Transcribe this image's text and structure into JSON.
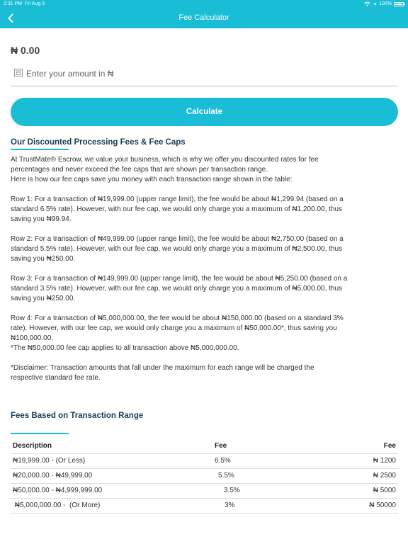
{
  "status_bar": {
    "time": "2:31 PM",
    "date": "Fri Aug 9",
    "battery": "100%"
  },
  "nav": {
    "title": "Fee Calculator",
    "back_icon": "chevron-left-icon"
  },
  "amount_display": "₦ 0.00",
  "amount_input": {
    "placeholder": "Enter your amount in ₦",
    "value": ""
  },
  "calculate_label": "Calculate",
  "discount_section": {
    "title": "Our Discounted Processing Fees & Fee Caps",
    "intro_lines": [
      "At TrustMate® Escrow, we value your business, which is why we offer you discounted rates for fee",
      "percentages and never exceed the fee caps that are shown per transaction range.",
      "Here is how our fee caps save you money with each transaction range shown in the table:"
    ],
    "row1_lines": [
      "Row 1: For a transaction of ₦19,999.00 (upper range limit), the fee would be about ₦1,299.94 (based on a",
      "standard 6.5% rate). However, with our fee cap, we would only charge you a maximum of ₦1,200.00, thus",
      "saving you ₦99.94."
    ],
    "row2_lines": [
      "Row 2: For a transaction of ₦49,999.00 (upper range limit), the fee would be about ₦2,750.00 (based on a",
      "standard 5.5% rate). However, with our fee cap, we would only charge you a maximum of ₦2,500.00, thus",
      "saving you ₦250.00."
    ],
    "row3_lines": [
      "Row 3: For a transaction of ₦149,999.00 (upper range limit), the fee would be about ₦5,250.00 (based on a",
      "standard 3.5% rate). However, with our fee cap, we would only charge you a maximum of ₦5,000.00, thus",
      "saving you ₦250.00."
    ],
    "row4_lines": [
      "Row 4: For a transaction of ₦5,000,000.00, the fee would be about ₦150,000.00 (based on a standard 3%",
      "rate). However, with our fee cap, we would only charge you a maximum of ₦50,000.00*, thus saving you",
      "₦100,000.00.",
      "*The ₦50,000.00 fee cap applies to all transaction above ₦5,000,000.00."
    ],
    "disclaimer_lines": [
      "*Disclaimer: Transaction amounts that fall under the maximum for each range will be charged the",
      "respective standard fee rate."
    ]
  },
  "fees_section": {
    "title": "Fees Based on Transaction Range",
    "headers": [
      "Description",
      "Fee",
      "Fee"
    ],
    "rows": [
      {
        "description": "₦19,999.00 - (Or Less)",
        "rate": "6.5%",
        "cap": "₦ 1200"
      },
      {
        "description": "₦20,000.00 - ₦49,999.00",
        "rate": "5.5%",
        "cap": "₦ 2500"
      },
      {
        "description": "₦50,000.00 - ₦4,999,999.00",
        "rate": "3.5%",
        "cap": "₦ 5000"
      },
      {
        "description": " ₦5,000,000.00 -  (Or More)",
        "rate": "3%",
        "cap": "₦ 50000"
      }
    ]
  },
  "colors": {
    "accent": "#19bdd6",
    "heading": "#1b3a4f",
    "text": "#333333"
  }
}
